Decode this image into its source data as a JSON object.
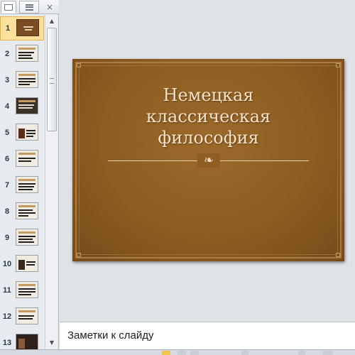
{
  "thumbnail_pane": {
    "close_glyph": "×",
    "slides": [
      {
        "number": "1",
        "selected": true
      },
      {
        "number": "2"
      },
      {
        "number": "3"
      },
      {
        "number": "4"
      },
      {
        "number": "5"
      },
      {
        "number": "6"
      },
      {
        "number": "7"
      },
      {
        "number": "8"
      },
      {
        "number": "9"
      },
      {
        "number": "10"
      },
      {
        "number": "11"
      },
      {
        "number": "12"
      },
      {
        "number": "13"
      }
    ],
    "scroll_up_glyph": "▲",
    "scroll_down_glyph": "▼"
  },
  "slide": {
    "title_line1": "Немецкая",
    "title_line2": "классическая",
    "title_line3": "философия",
    "ornament_glyph": "❧",
    "background_color": "#8c5c22",
    "title_color": "#f3e2c8"
  },
  "notes": {
    "placeholder": "Заметки к слайду"
  },
  "colors": {
    "selected_thumb_bg": "#fbe09a",
    "selected_thumb_border": "#e3b450",
    "pane_bg": "#e7eaee"
  }
}
